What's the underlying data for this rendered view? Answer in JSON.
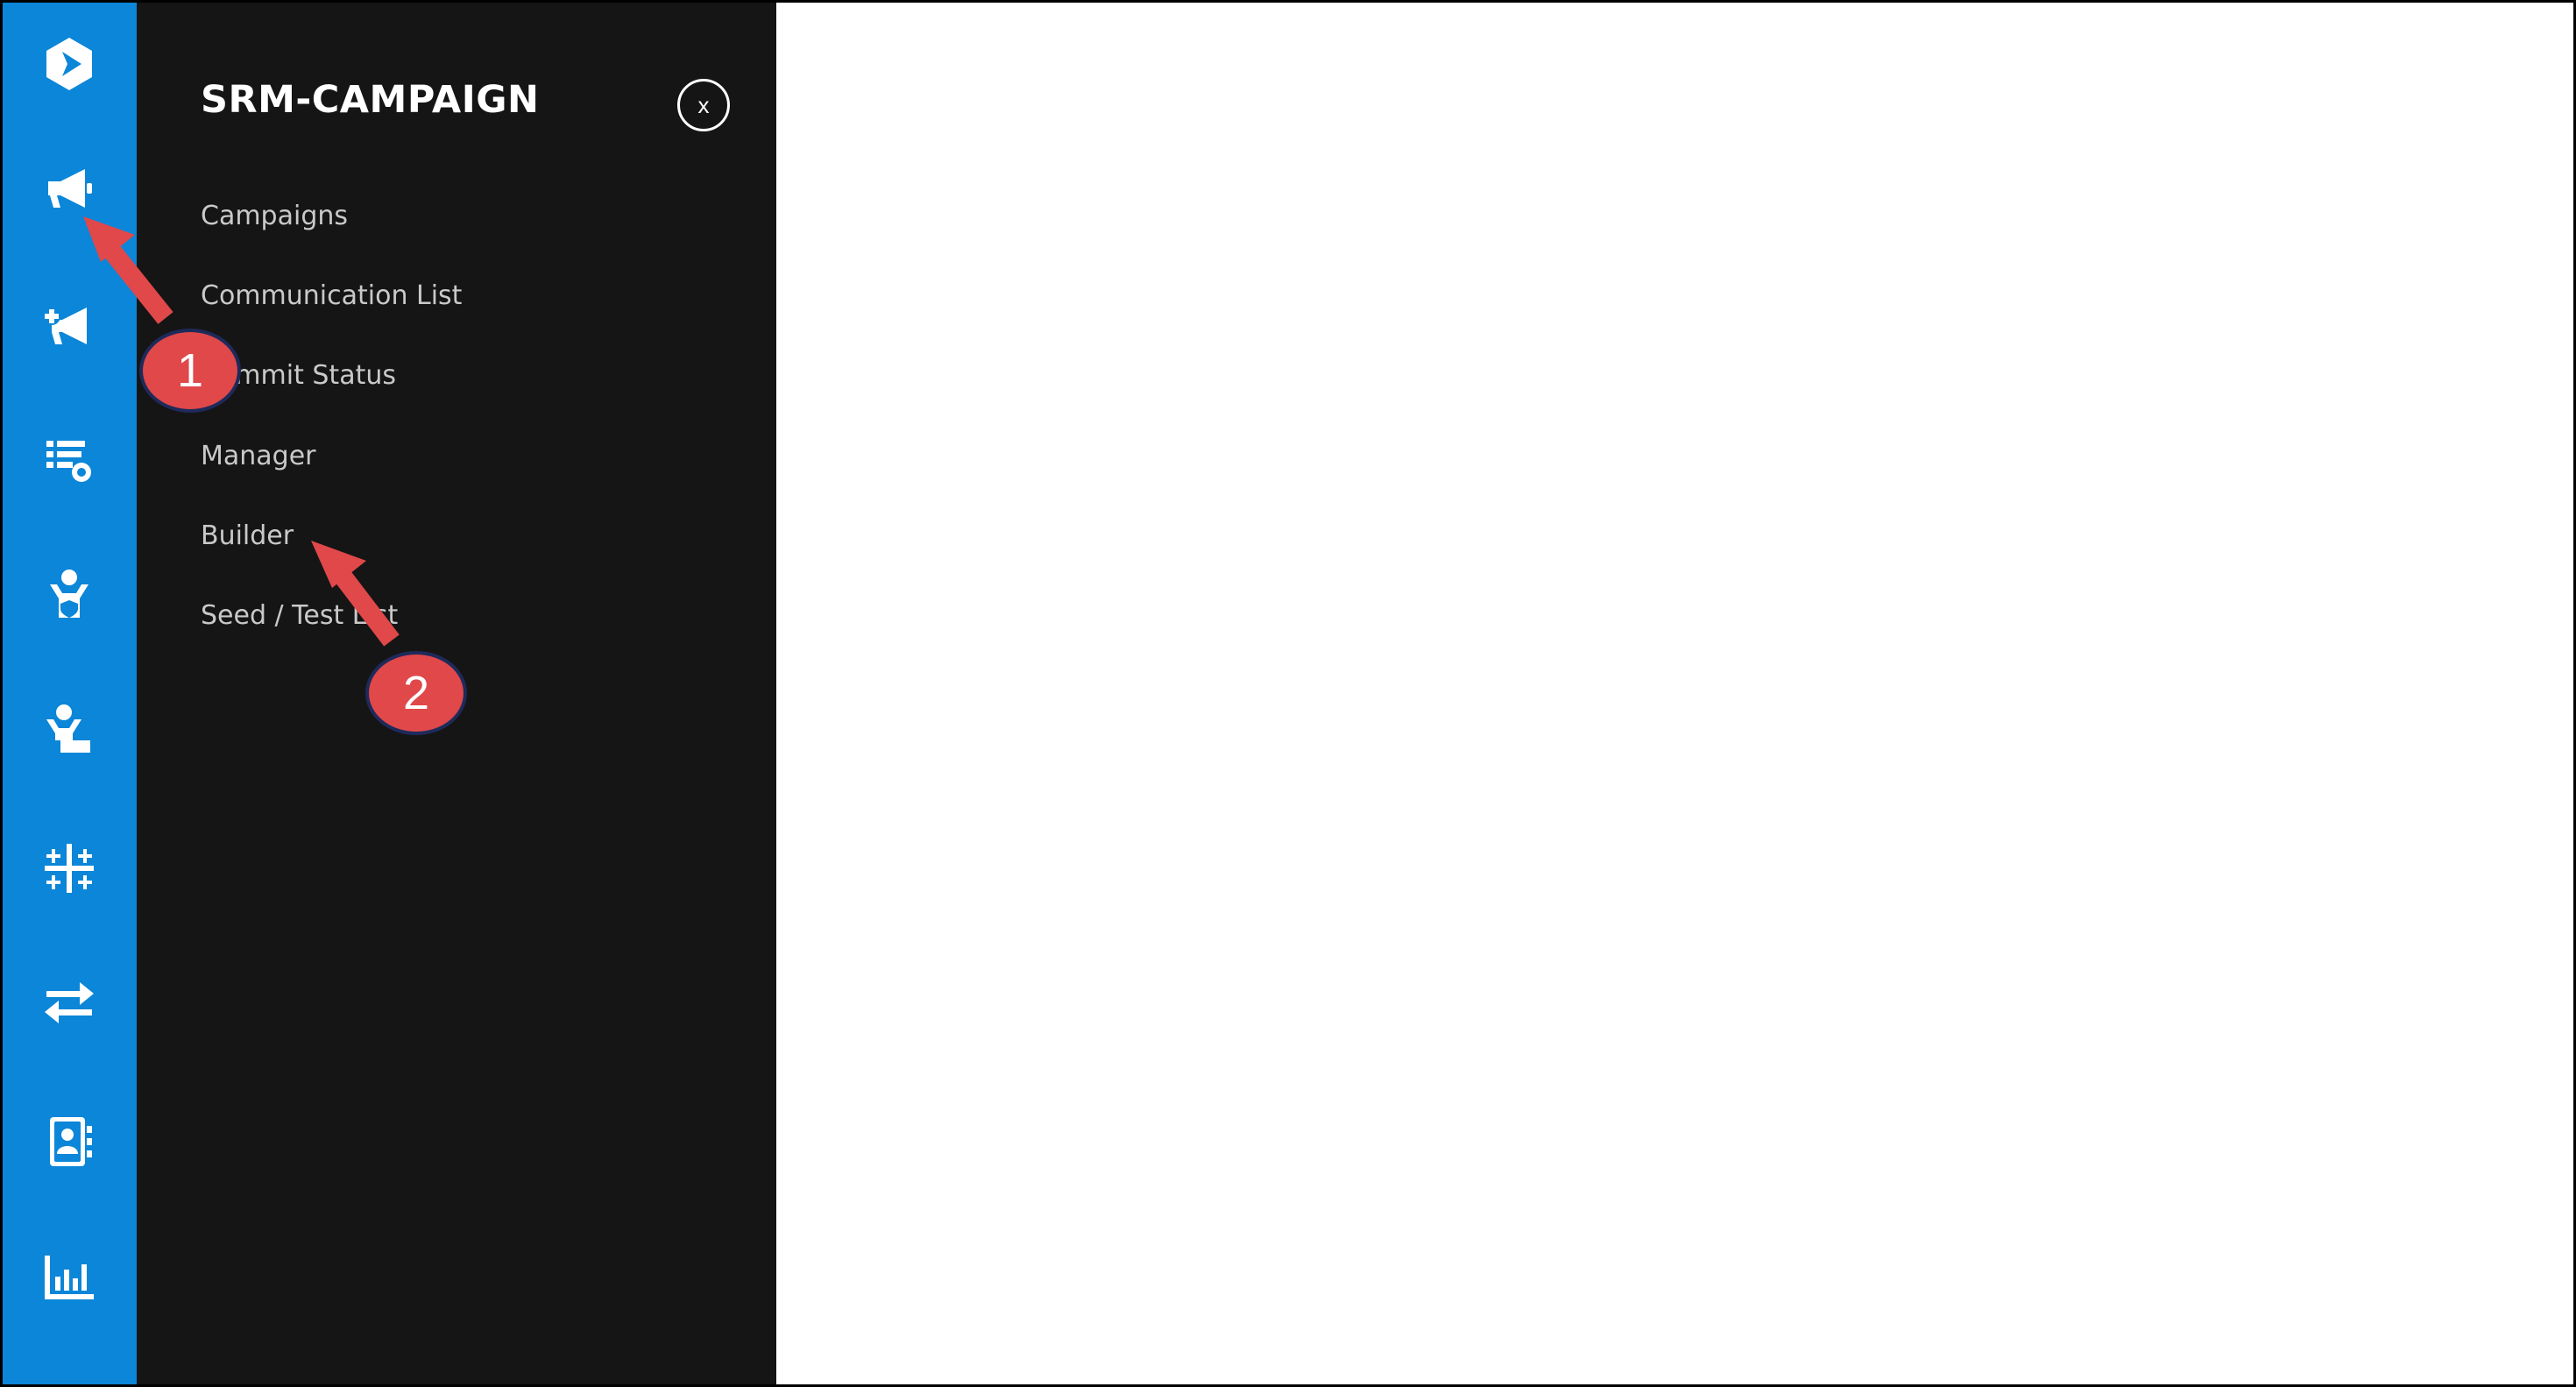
{
  "rail": {
    "items": [
      {
        "icon": "logo-icon"
      },
      {
        "icon": "megaphone-icon"
      },
      {
        "icon": "megaphone-add-icon"
      },
      {
        "icon": "list-settings-icon"
      },
      {
        "icon": "user-shield-icon"
      },
      {
        "icon": "user-desk-icon"
      },
      {
        "icon": "sparkle-grid-icon"
      },
      {
        "icon": "transfer-arrows-icon"
      },
      {
        "icon": "contact-book-icon"
      },
      {
        "icon": "bar-chart-icon"
      }
    ],
    "color": "#0b86d8"
  },
  "panel": {
    "title": "SRM-CAMPAIGN",
    "close_label": "x",
    "items": [
      {
        "label": "Campaigns"
      },
      {
        "label": "Communication List"
      },
      {
        "label": "Commit Status"
      },
      {
        "label": "Manager"
      },
      {
        "label": "Builder"
      },
      {
        "label": "Seed / Test List"
      }
    ],
    "background": "#151515"
  },
  "annotations": [
    {
      "number": "1"
    },
    {
      "number": "2"
    }
  ],
  "annotation_color": "#e0484a"
}
